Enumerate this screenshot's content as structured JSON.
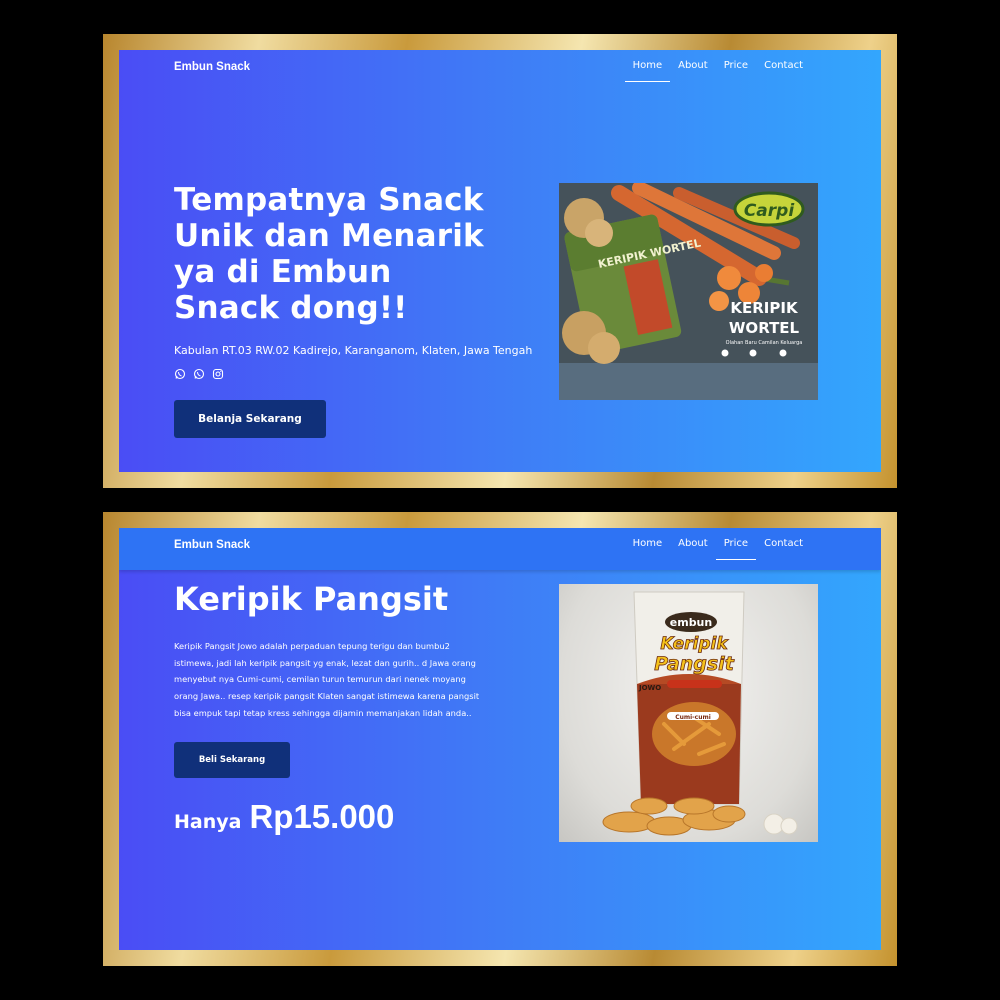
{
  "slide1": {
    "brand": "Embun Snack",
    "nav": [
      {
        "label": "Home",
        "active": true
      },
      {
        "label": "About",
        "active": false
      },
      {
        "label": "Price",
        "active": false
      },
      {
        "label": "Contact",
        "active": false
      }
    ],
    "hero_title": "Tempatnya Snack Unik dan Menarik ya di Embun Snack dong!!",
    "address": "Kabulan RT.03 RW.02 Kadirejo, Karanganom, Klaten, Jawa Tengah",
    "socials": [
      "whatsapp-icon",
      "whatsapp-icon",
      "instagram-icon"
    ],
    "cta_label": "Belanja Sekarang",
    "product_image": {
      "brand_text": "Carpi",
      "pack_text": "KERIPIK WORTEL",
      "headline": "KERIPIK",
      "headline2": "WORTEL",
      "tagline": "Olahan Baru Camilan Keluarga"
    }
  },
  "slide2": {
    "brand": "Embun Snack",
    "nav": [
      {
        "label": "Home",
        "active": false
      },
      {
        "label": "About",
        "active": false
      },
      {
        "label": "Price",
        "active": true
      },
      {
        "label": "Contact",
        "active": false
      }
    ],
    "product_title": "Keripik Pangsit",
    "description": "Keripik Pangsit Jowo adalah perpaduan tepung terigu dan bumbu2 istimewa, jadi lah keripik pangsit yg enak, lezat dan gurih.. d Jawa orang menyebut nya Cumi-cumi, cemilan turun temurun dari nenek moyang orang Jawa.. resep keripik pangsit Klaten sangat istimewa karena pangsit bisa empuk tapi tetap kress sehingga dijamin memanjakan lidah anda..",
    "cta_label": "Beli Sekarang",
    "price_prefix": "Hanya",
    "price_value": "Rp15.000",
    "product_image": {
      "brand_text": "embun",
      "pack_line1": "Keripik",
      "pack_line2": "Pangsit",
      "pack_sub": "JOWO",
      "variant": "Cumi-cumi"
    }
  },
  "colors": {
    "gradient_start": "#4a4df5",
    "gradient_end": "#33a6fd",
    "button_bg": "#10307a",
    "frame_gold": "#c99a3c"
  }
}
